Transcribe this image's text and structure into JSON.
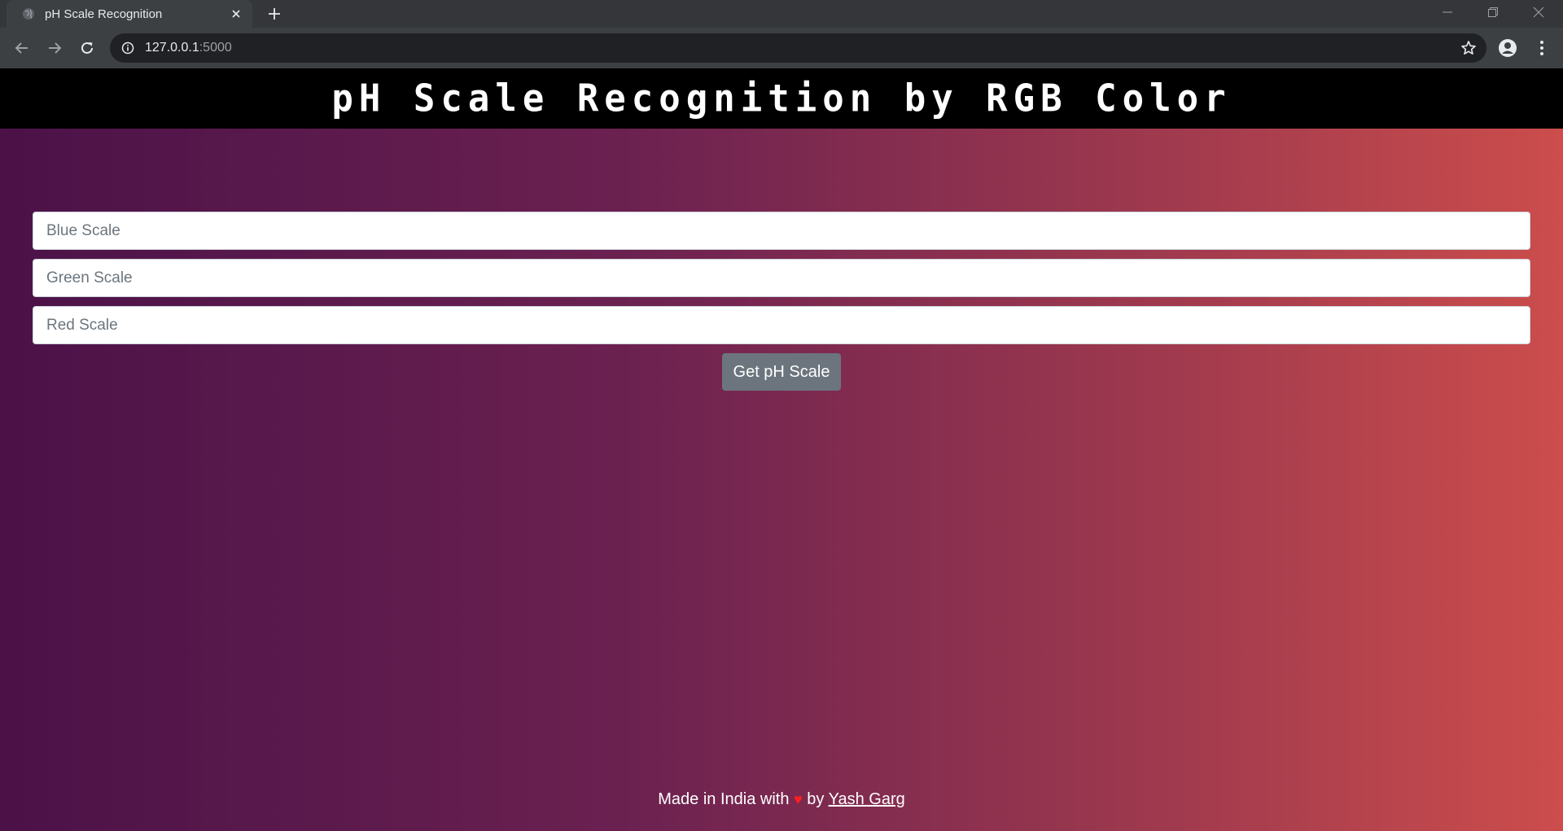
{
  "browser": {
    "tab_title": "pH Scale Recognition",
    "url_host": "127.0.0.1",
    "url_port": ":5000",
    "favicon_icon": "globe-icon",
    "close_icon": "close-icon",
    "new_tab_icon": "plus-icon"
  },
  "page": {
    "title": "pH Scale Recognition by RGB Color",
    "inputs": {
      "blue_placeholder": "Blue Scale",
      "green_placeholder": "Green Scale",
      "red_placeholder": "Red Scale"
    },
    "submit_label": "Get pH Scale",
    "footer": {
      "prefix": "Made in India with",
      "heart": "♥",
      "by": "by",
      "author": "Yash Garg"
    }
  },
  "colors": {
    "header_bg": "#000000",
    "gradient_start": "#4b1248",
    "gradient_end": "#cc4d4c",
    "button_bg": "#6c757d"
  }
}
